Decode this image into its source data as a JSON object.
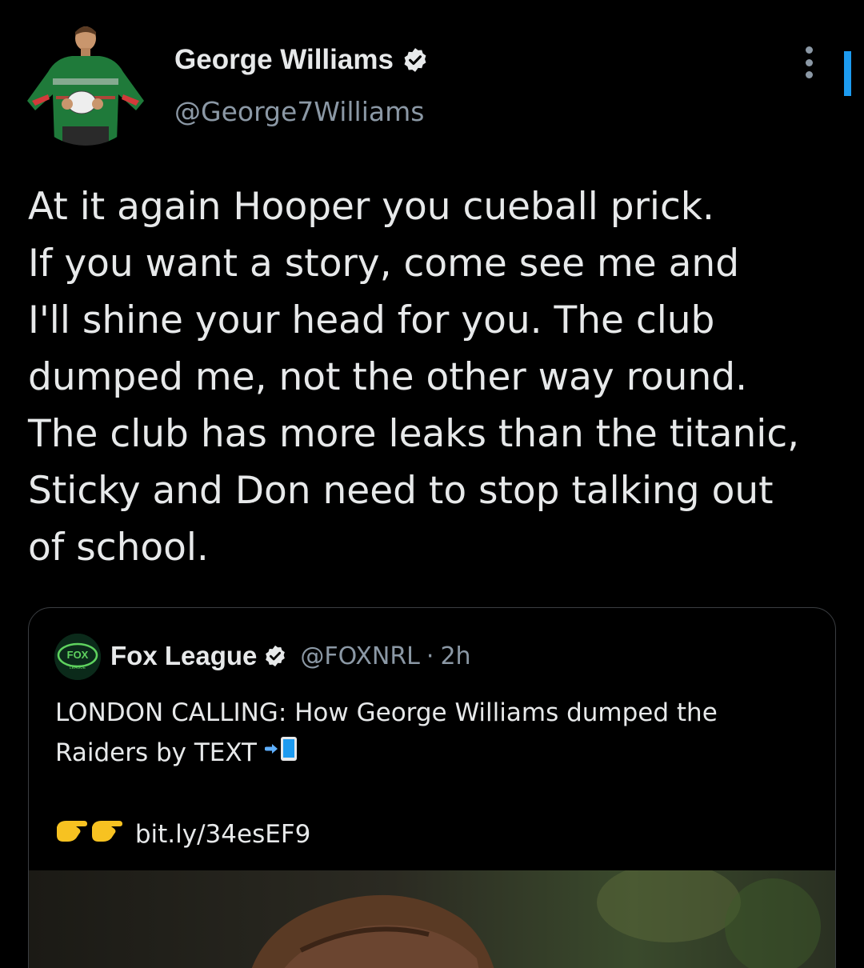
{
  "author": {
    "display_name": "George Williams",
    "handle": "@George7Williams",
    "verified": true,
    "avatar_icon": "avatar-player-photo"
  },
  "tweet": {
    "text": "At it again Hooper you cueball prick.\nIf you want a story, come see me and\nI'll shine your head for you. The club\ndumped me, not the other way round.\nThe club has more leaks than the titanic,\nSticky and Don need to stop talking out\nof school."
  },
  "quoted": {
    "display_name": "Fox League",
    "handle": "@FOXNRL",
    "separator": "·",
    "time": "2h",
    "verified": true,
    "avatar_text": "FOX",
    "avatar_subtext": "LEAGUE",
    "text_line1": "LONDON CALLING: How George Williams dumped the",
    "text_line2": "Raiders by TEXT",
    "link": "bit.ly/34esEF9",
    "line2_icon": "mobile-arrow-icon",
    "link_icon": "pointing-right-icon"
  },
  "colors": {
    "background": "#000000",
    "text_primary": "#e7e9ea",
    "text_secondary": "#8b98a5",
    "accent": "#1d9bf0",
    "card_border": "#3a3d41"
  }
}
